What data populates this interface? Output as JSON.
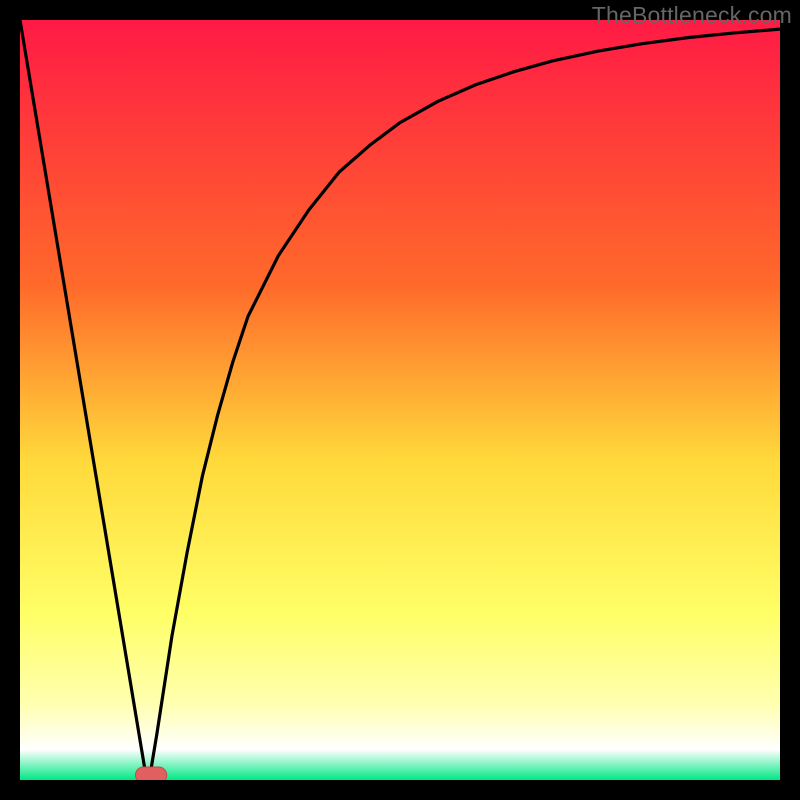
{
  "watermark": "TheBottleneck.com",
  "colors": {
    "frame": "#000000",
    "gradient_top": "#ff1a45",
    "gradient_mid1": "#ff6a2a",
    "gradient_mid2": "#ffd93b",
    "gradient_mid3": "#ffff66",
    "gradient_mid4": "#ffffb0",
    "gradient_white": "#ffffff",
    "gradient_bottom": "#00e884",
    "curve": "#000000",
    "optimum_fill": "#e06060",
    "optimum_stroke": "#c84848"
  },
  "chart_data": {
    "type": "line",
    "title": "",
    "xlabel": "",
    "ylabel": "",
    "xlim": [
      0,
      100
    ],
    "ylim": [
      0,
      100
    ],
    "x": [
      0,
      2,
      4,
      6,
      8,
      10,
      12,
      14,
      16,
      16.5,
      17,
      18,
      20,
      22,
      24,
      26,
      28,
      30,
      34,
      38,
      42,
      46,
      50,
      55,
      60,
      65,
      70,
      76,
      82,
      88,
      94,
      100
    ],
    "series": [
      {
        "name": "bottleneck-curve",
        "values": [
          100,
          88,
          76,
          64,
          52,
          40,
          28,
          16,
          4,
          1,
          0,
          6,
          19,
          30,
          40,
          48,
          55,
          61,
          69,
          75,
          80,
          83.5,
          86.5,
          89.3,
          91.5,
          93.2,
          94.6,
          95.9,
          96.9,
          97.7,
          98.3,
          98.8
        ]
      }
    ],
    "optimum_marker": {
      "x_start": 15.2,
      "x_end": 19.3,
      "y": 0
    },
    "grid": false,
    "legend": false
  }
}
